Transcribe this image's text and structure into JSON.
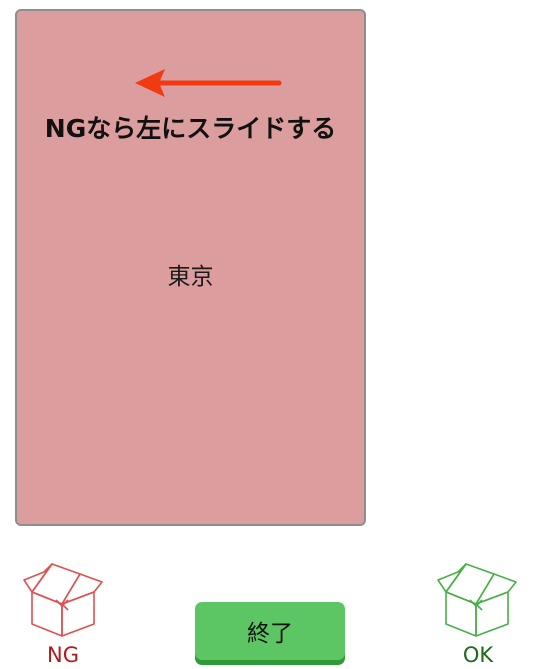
{
  "card": {
    "hint": "NGなら左にスライドする",
    "word": "東京"
  },
  "bins": {
    "ng_label": "NG",
    "ok_label": "OK"
  },
  "finish_button_label": "終了",
  "icons": {
    "hint_arrow": "arrow-left-icon",
    "ng_box": "open-box-icon",
    "ok_box": "open-box-icon"
  },
  "colors": {
    "card_background": "#db9d9d",
    "arrow": "#f23a12",
    "ng": "#e05050",
    "ok": "#48b048",
    "button": "#5cc665"
  }
}
